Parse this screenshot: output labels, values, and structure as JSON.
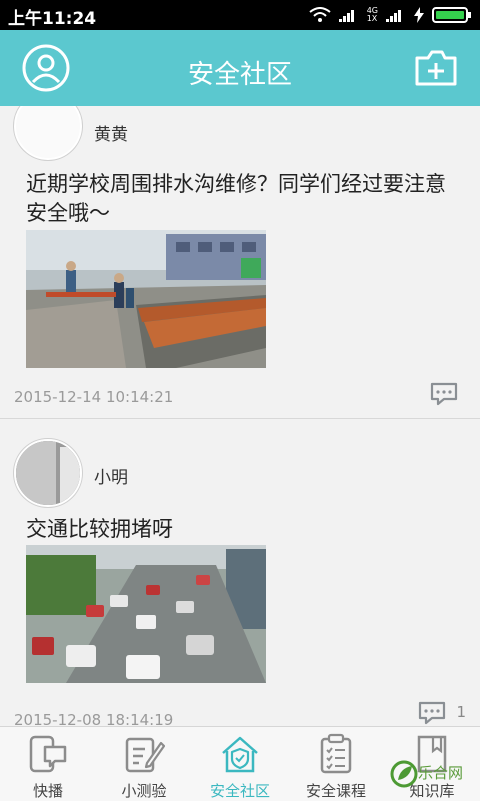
{
  "status": {
    "time": "上午11:24",
    "net_top": "4G",
    "net_bottom": "1X"
  },
  "header": {
    "title": "安全社区"
  },
  "posts": [
    {
      "user": "黄黄",
      "text": "近期学校周围排水沟维修？同学们经过要注意安全哦～",
      "time": "2015-12-14 10:14:21",
      "comments": ""
    },
    {
      "user": "小明",
      "text": "交通比较拥堵呀",
      "time": "2015-12-08 18:14:19",
      "comments": "1"
    }
  ],
  "tabs": [
    {
      "label": "快播",
      "icon": "chat-phone-icon"
    },
    {
      "label": "小测验",
      "icon": "pencil-note-icon"
    },
    {
      "label": "安全社区",
      "icon": "shield-house-icon",
      "active": true
    },
    {
      "label": "安全课程",
      "icon": "clipboard-icon"
    },
    {
      "label": "知识库",
      "icon": "book-icon"
    }
  ],
  "watermark": {
    "text": "乐合网"
  },
  "colors": {
    "primary": "#5bc8cf",
    "active_tab": "#3bb8c0"
  }
}
